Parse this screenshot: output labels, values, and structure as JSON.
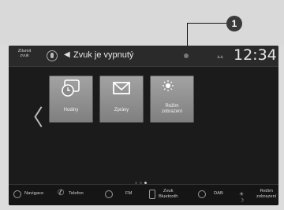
{
  "callout": {
    "number": "1"
  },
  "status_bar": {
    "sound_label_line1": "Ztlumit",
    "sound_label_line2": "zvuk",
    "status_text": "Zvuk je vypnutý",
    "clock": "12:34"
  },
  "home": {
    "tiles": [
      {
        "label_line1": "Hodiny",
        "label_line2": "",
        "icon": "clock-icon"
      },
      {
        "label_line1": "Zprávy",
        "label_line2": "",
        "icon": "envelope-icon"
      },
      {
        "label_line1": "Režim",
        "label_line2": "zobrazení",
        "icon": "day-night-icon"
      }
    ],
    "page_count": 3,
    "active_page": 3
  },
  "bottom_bar": {
    "items": [
      {
        "line1": "Navigace",
        "line2": "",
        "icon": "navigation-icon"
      },
      {
        "line1": "Telefon",
        "line2": "",
        "icon": "phone-icon"
      },
      {
        "line1": "FM",
        "line2": "",
        "icon": "fm-icon"
      },
      {
        "line1": "Zvuk",
        "line2": "Bluetooth",
        "icon": "bluetooth-icon"
      },
      {
        "line1": "DAB",
        "line2": "",
        "icon": "dab-icon"
      },
      {
        "line1": "Režim",
        "line2": "zobrazení",
        "icon": "day-night-icon"
      }
    ]
  }
}
